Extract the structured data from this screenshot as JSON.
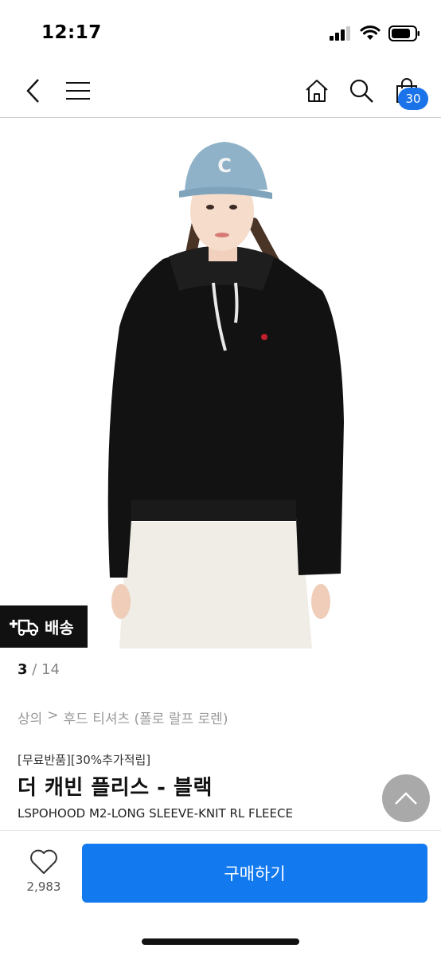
{
  "status": {
    "time": "12:17"
  },
  "nav": {
    "cart_count": "30"
  },
  "product": {
    "shipping_label": "배송",
    "pager": {
      "current": "3",
      "separator": "/",
      "total": "14"
    },
    "breadcrumb": {
      "category": "상의",
      "separator": ">",
      "subcategory": "후드 티셔츠 (폴로 랄프 로렌)"
    },
    "tags": "[무료반품][30%추가적립]",
    "title": "더 캐빈 플리스 - 블랙",
    "subtitle": "LSPOHOOD M2-LONG SLEEVE-KNIT RL FLEECE"
  },
  "bottom": {
    "like_count": "2,983",
    "buy_label": "구매하기"
  },
  "colors": {
    "accent": "#1279ee",
    "badge": "#1a73e8",
    "shipping_bg": "#111111"
  }
}
